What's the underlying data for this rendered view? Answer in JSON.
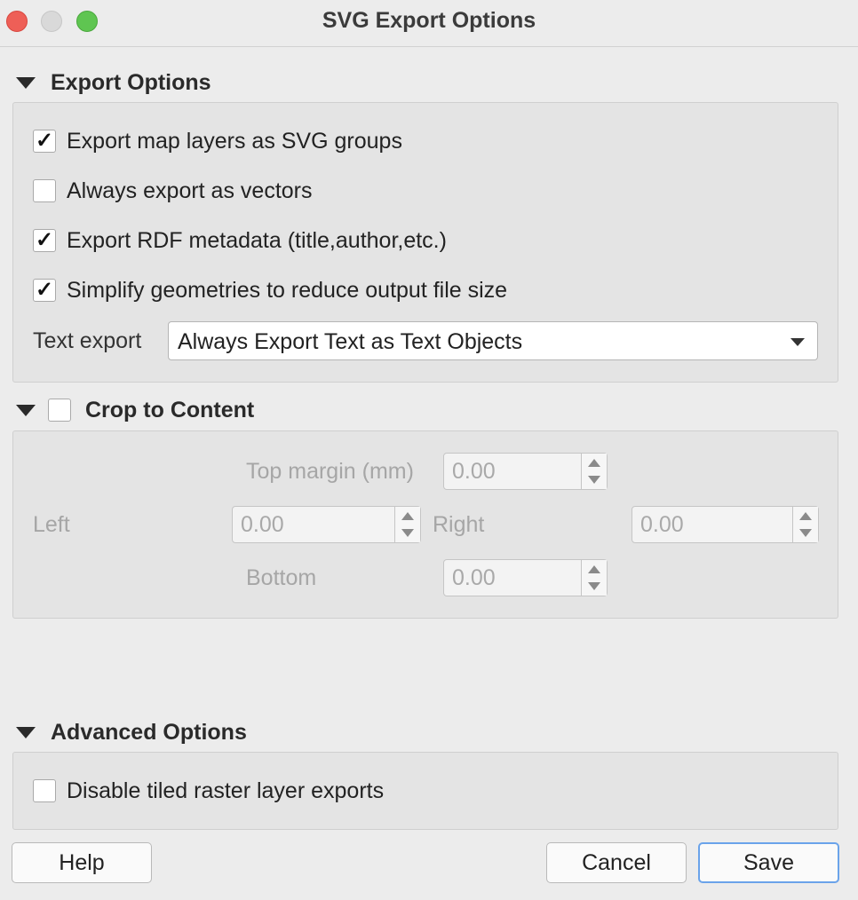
{
  "window": {
    "title": "SVG Export Options"
  },
  "export_options": {
    "header": "Export Options",
    "items": [
      {
        "label": "Export map layers as SVG groups",
        "checked": true
      },
      {
        "label": "Always export as vectors",
        "checked": false
      },
      {
        "label": "Export RDF metadata (title,author,etc.)",
        "checked": true
      },
      {
        "label": "Simplify geometries to reduce output file size",
        "checked": true
      }
    ],
    "text_export_label": "Text export",
    "text_export_value": "Always Export Text as Text Objects"
  },
  "crop": {
    "header": "Crop to Content",
    "checked": false,
    "top_label": "Top margin (mm)",
    "top_value": "0.00",
    "left_label": "Left",
    "left_value": "0.00",
    "right_label": "Right",
    "right_value": "0.00",
    "bottom_label": "Bottom",
    "bottom_value": "0.00"
  },
  "advanced": {
    "header": "Advanced Options",
    "items": [
      {
        "label": "Disable tiled raster layer exports",
        "checked": false
      }
    ]
  },
  "buttons": {
    "help": "Help",
    "cancel": "Cancel",
    "save": "Save"
  },
  "check_glyph": "✓"
}
